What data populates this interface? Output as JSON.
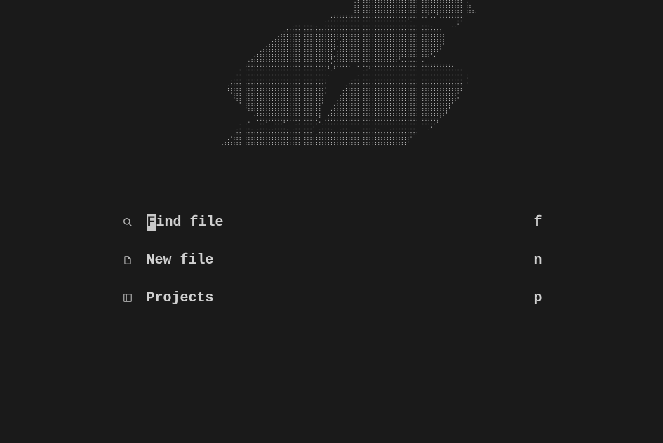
{
  "ascii_art": "                                                         .:::::::::::::::::::::::::::::::::::::.\n                                                         ::::::::::::::::::::::::::::::::::::::::\n                                                         :::::::::::::::::::::::::::::::::::::::::.\n                                                 .::::::::::::::::::::::::::::::::'..':::::::::\n                                               .:::::::::::::::::::::::::::'.               ::\n                                    .:::::::.  ::::::::::::::::::::::::::::::::::::.      ..'\n                                 .:::::::::::::::::::::::::::::::::::::::::::::::::::::\n                               .::::::::::::::::::::::::::::::::::::::::::::::::::::::::\n                             .:::::::::::::::::::::'.:::::::::::::::::::::::::::::::::::\n                           .:::::::::::::::::::::::.:::::::::::::::::::::::::::::::::::'\n                         .::::::::::::::::::::::::'.::::::::::::::::::::::::::::::::::'\n                       .::::::::::::::::::::::::::.::::::::::::::::::::::::::::::::'.\n                     .:::::::::::::::::::::::::::'.:::::::::::::::::::::'........\n                   .:::::::::::::::::::::::::::::':::::.  .::..:::::::::::::::::::::::::::.\n                  ::::::::::::::::::::::::::::::'.'         .:'::::::::::::::::::::::::::::::::\n                 :::::::::::::::::::::::::::::::.         .:::::::::::::::::::::::::::::::::::::\n               .::::::::::::::::::::::::::::::::        .::::::::::::::::::::::::::::::::::::::'\n              .::::::::::::::::::::::::::::::::'      .::::::::::::::::::::::::::::::::::::::::'\n              :::::::::::::::::::::::::::::::::'     .::::::::::::::::::::::::::::::::::::::::'\n               ':::::::::::::::::::::::::::::::'    .:::::::::::::::::::::::::::::::::::::::'\n                '::::::::::::::::::::::::::::::    .::::::::::::::::::::::::::::::::::::::::'\n                  ':::::::::::::::::::::::::::'   .:::::::::::::::::::::::::::::::::::::::'\n                    ':::::::::::::::::::::::::   .:::::::::::::::::::::::::::::::::::::::'\n                       .::::::::::::::::::::::  .:::::::::::::::::::::::::::::::::::::::'\n                        .::::::::::::::::::::' .::::::::::::::::::::::::::::::::::::::'\n                  .::'   ::'  :::'   .:::::::'.::::::::::::::::::::::::::::::::::::::'\n                 .::::. .:::..::::. .::::::' .:::.  .::.   .:::::.   .::::::::.   .'\n                .::::::::::::::::::::::::::'.::::::::::::::::::::::::::::::::::'\n              .'::::::::::::::::::::::::::::::::::::::::::::::::::::::::::::'\n            .::::::::::::::::::::::::::::::::::::::::::::::::::::::::::::::'",
  "menu": {
    "items": [
      {
        "label_first_char": "F",
        "label_rest": "ind file",
        "shortcut": "f",
        "icon": "search-icon",
        "cursor": true
      },
      {
        "label": "New file",
        "shortcut": "n",
        "icon": "file-icon"
      },
      {
        "label": "Projects",
        "shortcut": "p",
        "icon": "layout-icon"
      }
    ]
  }
}
